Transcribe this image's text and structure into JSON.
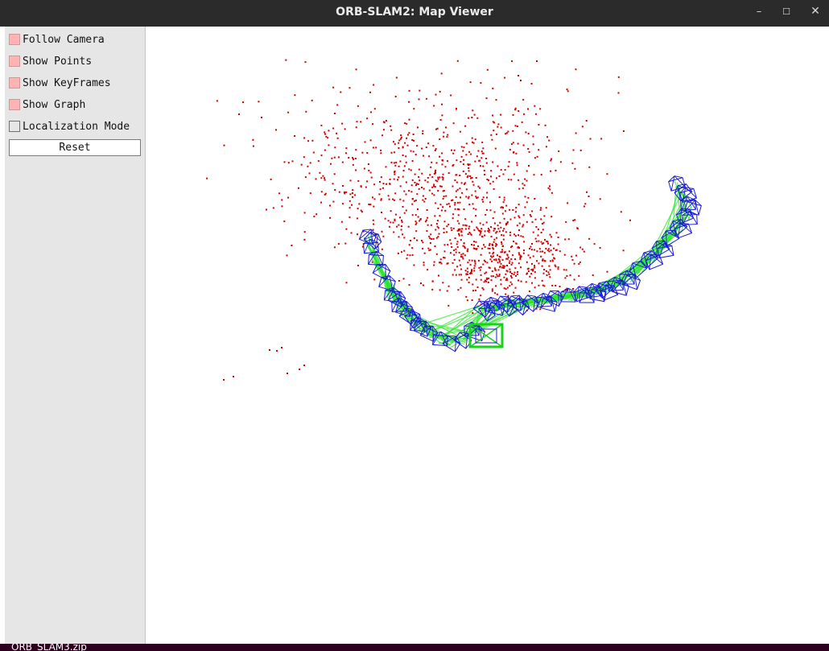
{
  "window": {
    "title": "ORB-SLAM2: Map Viewer",
    "controls": [
      "minimize",
      "maximize",
      "close"
    ]
  },
  "panel": {
    "options": [
      {
        "label": "Follow Camera",
        "checked": true
      },
      {
        "label": "Show Points",
        "checked": true
      },
      {
        "label": "Show KeyFrames",
        "checked": true
      },
      {
        "label": "Show Graph",
        "checked": true
      },
      {
        "label": "Localization Mode",
        "checked": false
      }
    ],
    "reset_label": "Reset"
  },
  "desktop": {
    "file_label": "ORB_SLAM3.zip"
  },
  "colors": {
    "map_points": "#d40000",
    "keyframes": "#1a1ad6",
    "graph": "#2ee62e",
    "current_camera": "#19d119",
    "checkbox_on": "#ffb3b3",
    "panel_bg": "#e6e6e6",
    "titlebar_bg": "#2b2b2b"
  }
}
